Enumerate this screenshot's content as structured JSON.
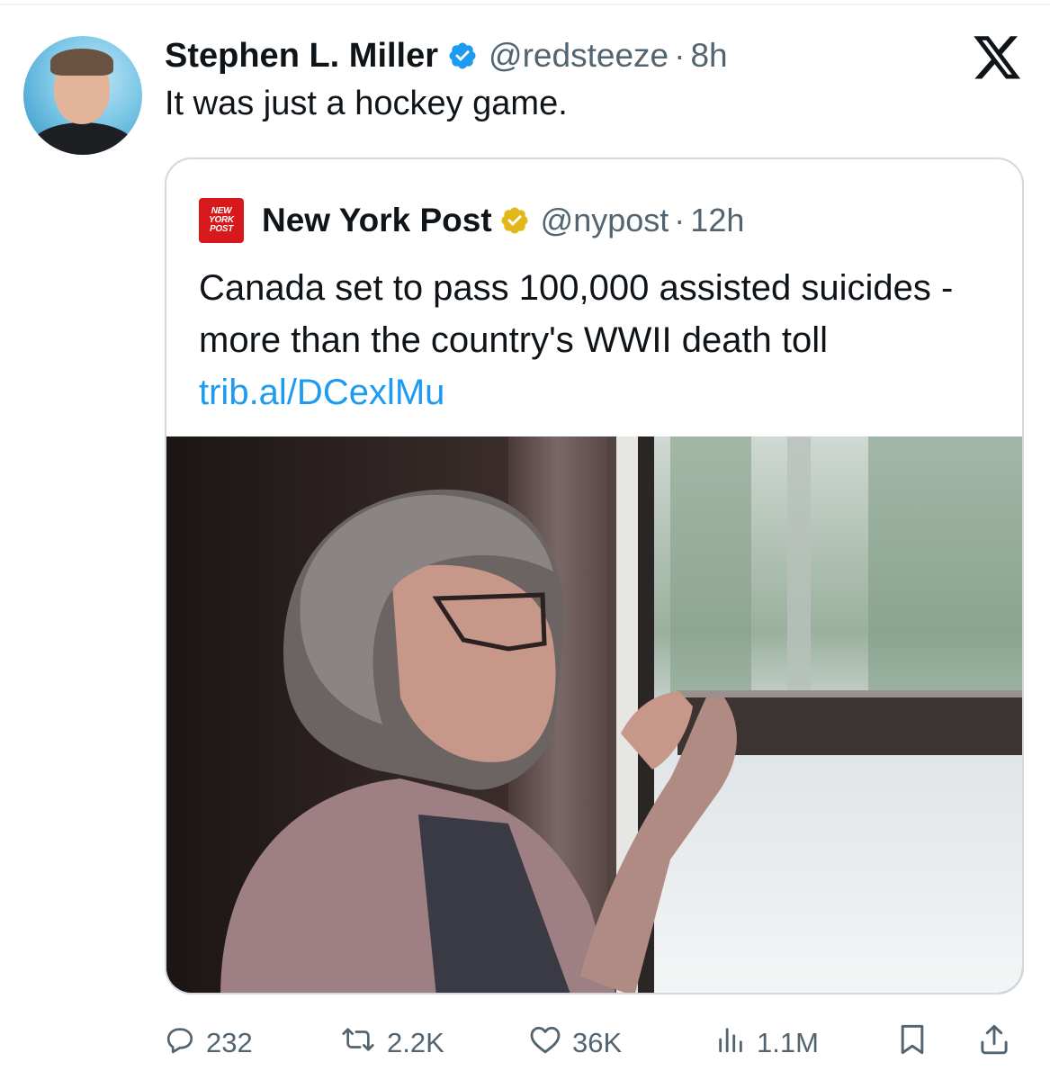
{
  "tweet": {
    "display_name": "Stephen L. Miller",
    "handle": "@redsteeze",
    "separator": "·",
    "time": "8h",
    "text": "It was just a hockey game."
  },
  "quoted_tweet": {
    "logo_lines": [
      "NEW",
      "YORK",
      "POST"
    ],
    "display_name": "New York Post",
    "handle": "@nypost",
    "separator": "·",
    "time": "12h",
    "text": "Canada set to pass 100,000 assisted suicides - more than the country's WWII death toll",
    "link": "trib.al/DCexlMu"
  },
  "actions": {
    "replies": "232",
    "reposts": "2.2K",
    "likes": "36K",
    "views": "1.1M"
  },
  "icons": {
    "verified_personal": "verified-badge-blue",
    "verified_org": "verified-badge-gold",
    "close": "x-logo-icon",
    "reply": "reply-icon",
    "repost": "repost-icon",
    "like": "heart-icon",
    "views": "views-icon",
    "bookmark": "bookmark-icon",
    "share": "share-icon"
  },
  "colors": {
    "text_primary": "#0f1419",
    "text_secondary": "#536471",
    "link": "#1d9bf0",
    "verified_blue": "#1d9bf0",
    "verified_gold": "#e2b719",
    "nyp_red": "#d7191c",
    "border": "#cfd9de"
  }
}
